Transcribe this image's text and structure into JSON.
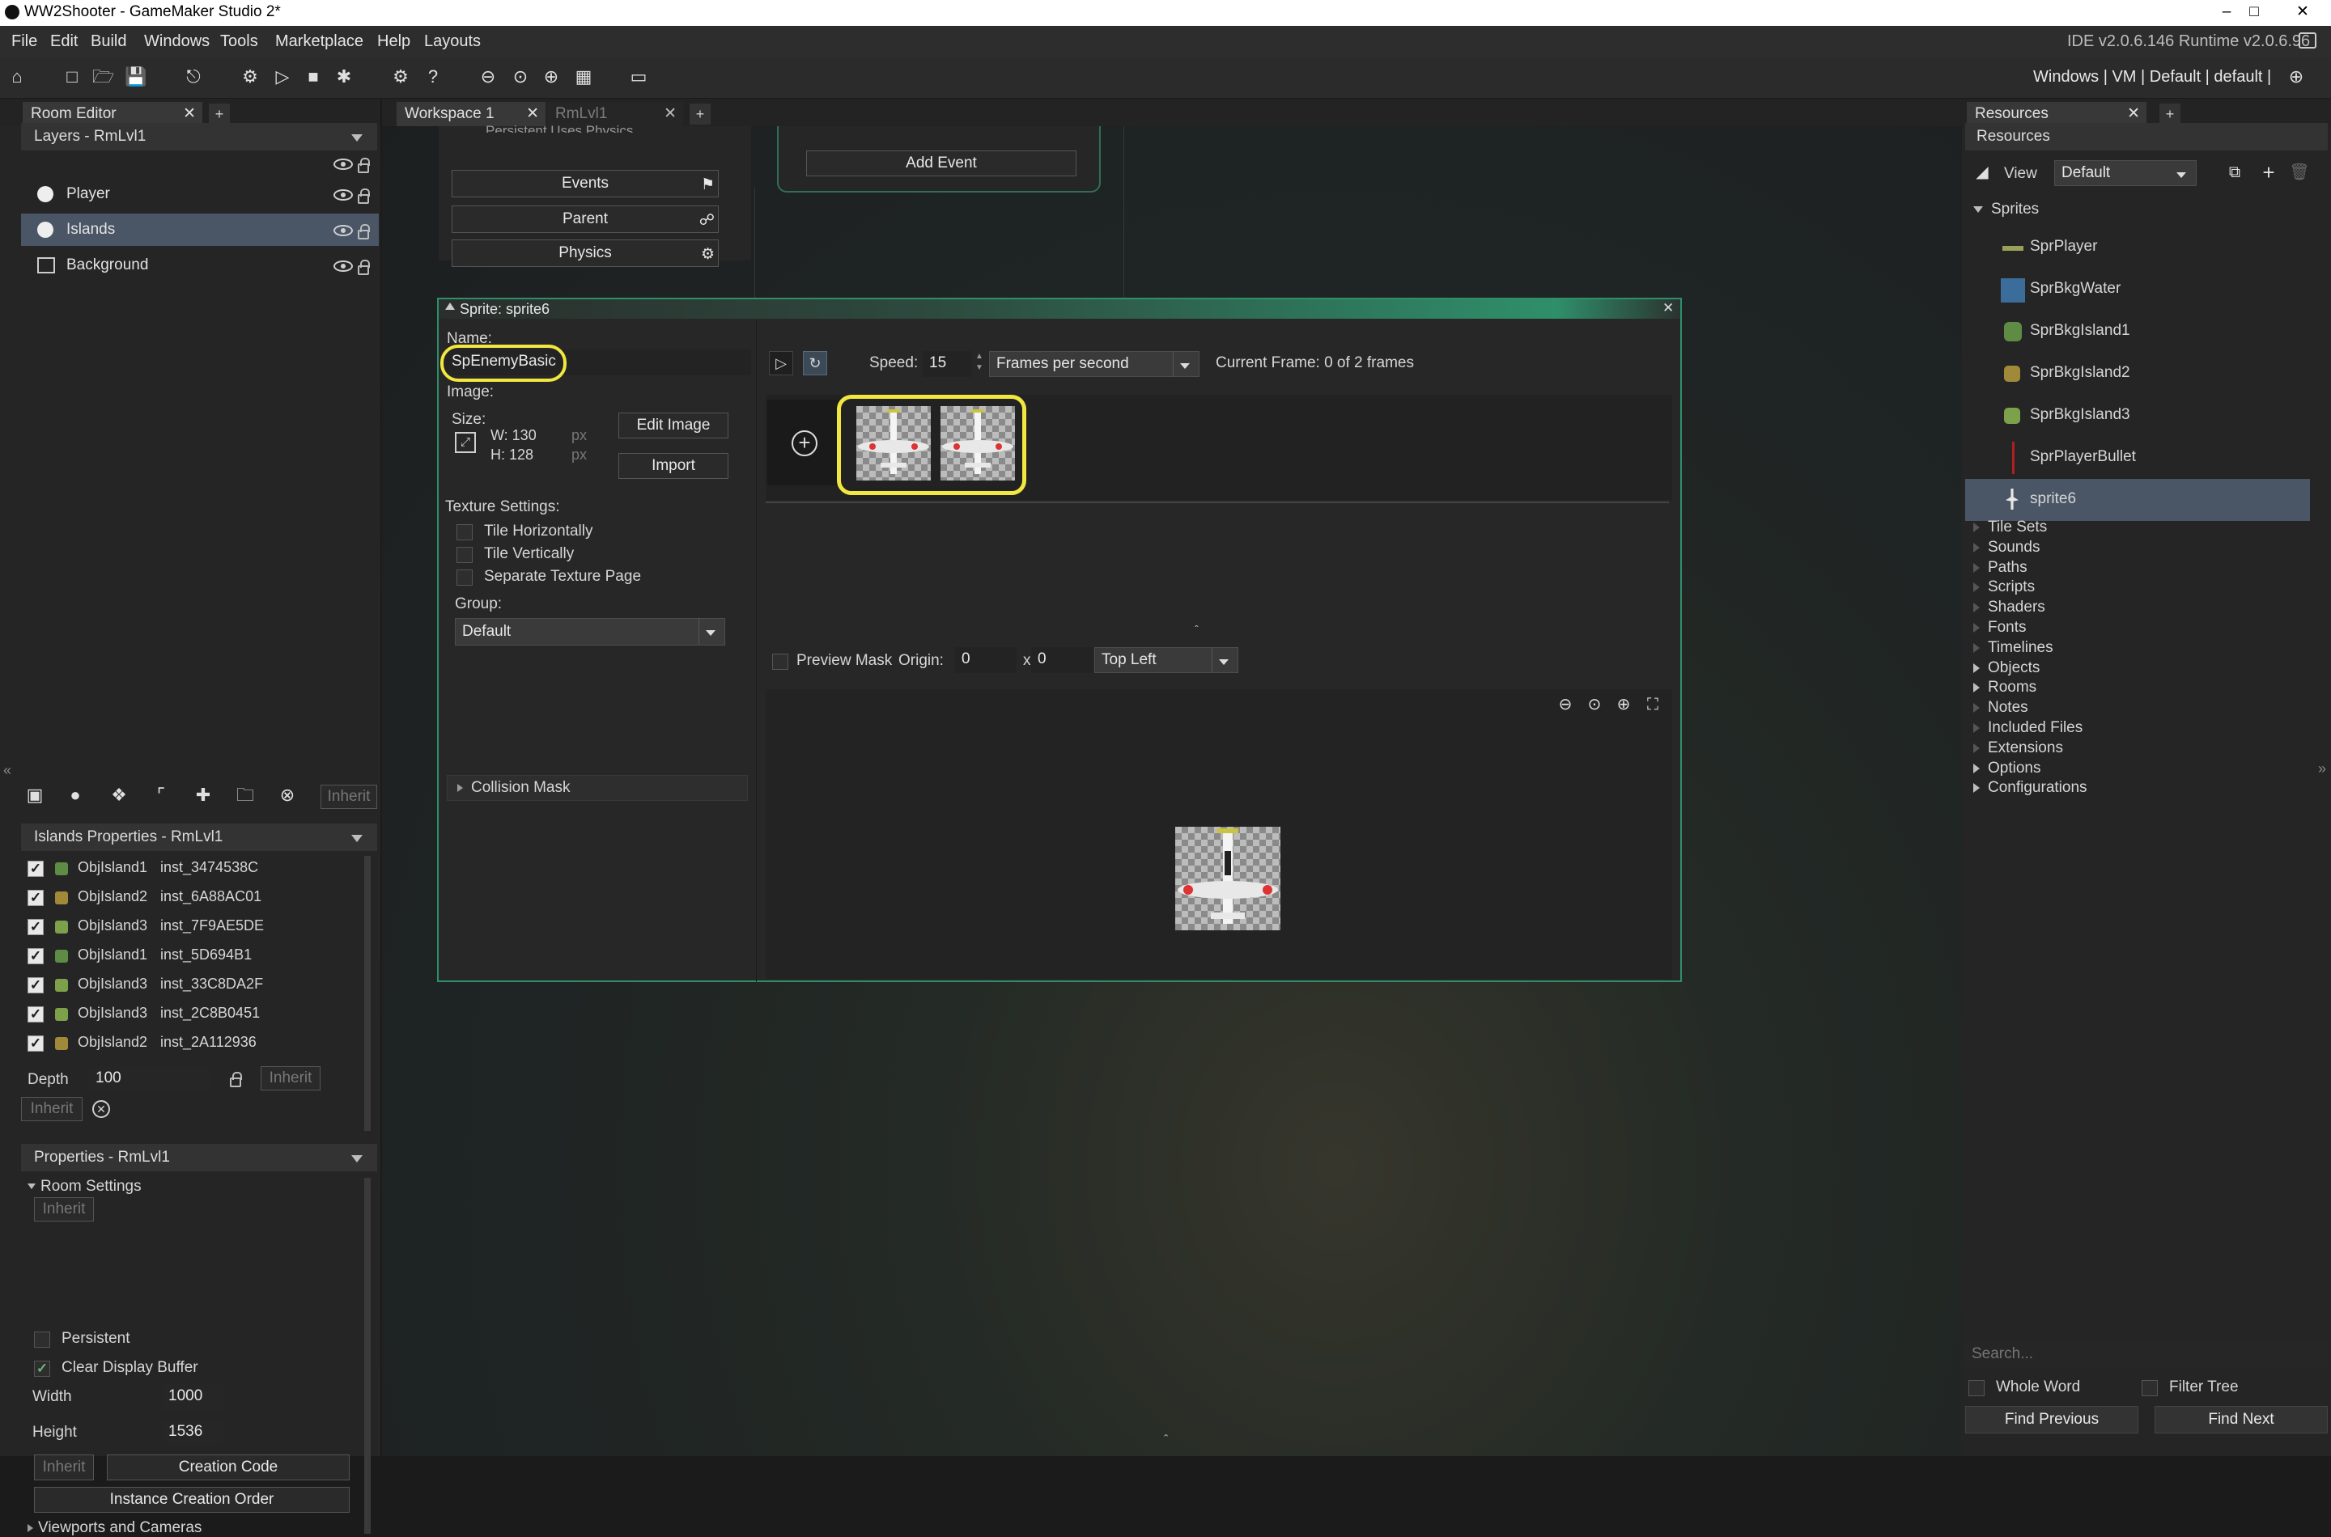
{
  "window": {
    "title": "WW2Shooter - GameMaker Studio 2*"
  },
  "menu": [
    "File",
    "Edit",
    "Build",
    "Windows",
    "Tools",
    "Marketplace",
    "Help",
    "Layouts"
  ],
  "toolbar": {
    "ide_version": "IDE v2.0.6.146 Runtime v2.0.6.96",
    "target": "Windows | VM | Default | default |"
  },
  "left": {
    "tab": "Room Editor",
    "layers_header": "Layers - RmLvl1",
    "layers": [
      {
        "name": "Player"
      },
      {
        "name": "Islands"
      },
      {
        "name": "Background"
      }
    ],
    "inherit_label": "Inherit",
    "islands_header": "Islands Properties - RmLvl1",
    "instances": [
      {
        "obj": "ObjIsland1",
        "inst": "inst_3474538C"
      },
      {
        "obj": "ObjIsland2",
        "inst": "inst_6A88AC01"
      },
      {
        "obj": "ObjIsland3",
        "inst": "inst_7F9AE5DE"
      },
      {
        "obj": "ObjIsland1",
        "inst": "inst_5D694B1"
      },
      {
        "obj": "ObjIsland3",
        "inst": "inst_33C8DA2F"
      },
      {
        "obj": "ObjIsland3",
        "inst": "inst_2C8B0451"
      },
      {
        "obj": "ObjIsland2",
        "inst": "inst_2A112936"
      }
    ],
    "depth_label": "Depth",
    "depth_value": "100",
    "inherit2": "Inherit",
    "inherit3": "Inherit",
    "props_header": "Properties - RmLvl1",
    "room_settings": "Room Settings",
    "inherit4": "Inherit",
    "persistent": "Persistent",
    "clear_display": "Clear Display Buffer",
    "width_label": "Width",
    "width_value": "1000",
    "height_label": "Height",
    "height_value": "1536",
    "inherit5": "Inherit",
    "creation_code": "Creation Code",
    "instance_order": "Instance Creation Order",
    "viewports": "Viewports and Cameras"
  },
  "workspace": {
    "tabs": [
      "Workspace 1",
      "RmLvl1"
    ],
    "object_buttons": [
      "Events",
      "Parent",
      "Physics"
    ],
    "add_event": "Add Event",
    "peek_text": "Persistent  Uses Physics"
  },
  "sprite": {
    "title": "Sprite: sprite6",
    "name_label": "Name:",
    "name_value": "SpEnemyBasic",
    "image_label": "Image:",
    "size_label": "Size:",
    "w_label": "W: 130",
    "h_label": "H: 128",
    "px": "px",
    "edit_image": "Edit Image",
    "import": "Import",
    "texture_label": "Texture Settings:",
    "tile_h": "Tile Horizontally",
    "tile_v": "Tile Vertically",
    "separate": "Separate Texture Page",
    "group_label": "Group:",
    "group_value": "Default",
    "collision": "Collision Mask",
    "speed_label": "Speed:",
    "speed_value": "15",
    "fps": "Frames per second",
    "current_frame": "Current Frame: 0 of 2 frames",
    "preview_mask": "Preview Mask",
    "origin_label": "Origin:",
    "origin_x": "0",
    "x_sep": "x",
    "origin_y": "0",
    "origin_preset": "Top Left",
    "frame_count": 2
  },
  "resources": {
    "tab": "Resources",
    "header": "Resources",
    "view_label": "View",
    "view_value": "Default",
    "sprites_label": "Sprites",
    "sprites": [
      "SprPlayer",
      "SprBkgWater",
      "SprBkgIsland1",
      "SprBkgIsland2",
      "SprBkgIsland3",
      "SprPlayerBullet",
      "sprite6"
    ],
    "groups": [
      "Tile Sets",
      "Sounds",
      "Paths",
      "Scripts",
      "Shaders",
      "Fonts",
      "Timelines",
      "Objects",
      "Rooms",
      "Notes",
      "Included Files",
      "Extensions",
      "Options",
      "Configurations"
    ],
    "search_placeholder": "Search...",
    "whole_word": "Whole Word",
    "filter_tree": "Filter Tree",
    "find_prev": "Find Previous",
    "find_next": "Find Next"
  },
  "colors": {
    "accent_green": "#2f8f6a",
    "highlight_yellow": "#f2e640",
    "selection": "#4a5566"
  }
}
